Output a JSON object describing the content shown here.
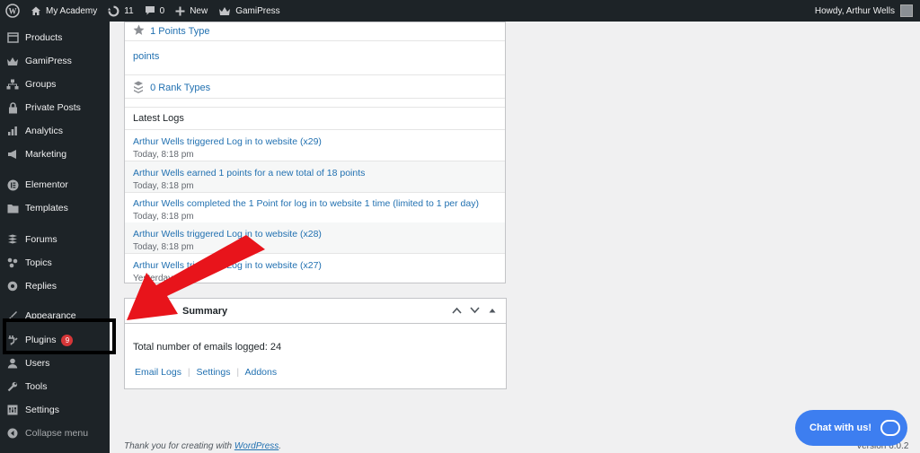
{
  "adminbar": {
    "site_name": "My Academy",
    "updates_count": "11",
    "comments_count": "0",
    "new_label": "New",
    "gamipress_label": "GamiPress",
    "howdy": "Howdy, Arthur Wells"
  },
  "sidebar": {
    "items": [
      {
        "label": "Products",
        "icon": "products-icon"
      },
      {
        "label": "GamiPress",
        "icon": "crown-icon"
      },
      {
        "label": "Groups",
        "icon": "groups-icon"
      },
      {
        "label": "Private Posts",
        "icon": "lock-icon"
      },
      {
        "label": "Analytics",
        "icon": "analytics-icon"
      },
      {
        "label": "Marketing",
        "icon": "megaphone-icon"
      },
      {
        "label": "Elementor",
        "icon": "elementor-icon"
      },
      {
        "label": "Templates",
        "icon": "folder-icon"
      },
      {
        "label": "Forums",
        "icon": "forums-icon"
      },
      {
        "label": "Topics",
        "icon": "topics-icon"
      },
      {
        "label": "Replies",
        "icon": "replies-icon"
      },
      {
        "label": "Appearance",
        "icon": "brush-icon"
      },
      {
        "label": "Plugins",
        "icon": "plugin-icon",
        "badge": "9"
      },
      {
        "label": "Users",
        "icon": "user-icon"
      },
      {
        "label": "Tools",
        "icon": "wrench-icon"
      },
      {
        "label": "Settings",
        "icon": "settings-icon"
      },
      {
        "label": "Collapse menu",
        "icon": "collapse-icon"
      }
    ]
  },
  "gamipress": {
    "points_types": "1 Points Type",
    "points_item": "points",
    "rank_types": "0 Rank Types",
    "latest_logs_title": "Latest Logs",
    "logs": [
      {
        "text": "Arthur Wells triggered Log in to website (x29)",
        "time": "Today, 8:18 pm"
      },
      {
        "text": "Arthur Wells earned 1 points for a new total of 18 points",
        "time": "Today, 8:18 pm"
      },
      {
        "text": "Arthur Wells completed the 1 Point for log in to website 1 time (limited to 1 per day)",
        "time": "Today, 8:18 pm"
      },
      {
        "text": "Arthur Wells triggered Log in to website (x28)",
        "time": "Today, 8:18 pm"
      },
      {
        "text": "Arthur Wells triggered Log in to website (x27)",
        "time": "Yesterday"
      }
    ]
  },
  "email_summary": {
    "title": "Summary",
    "total": "Total number of emails logged: 24",
    "links": [
      "Email Logs",
      "Settings",
      "Addons"
    ]
  },
  "chat": {
    "label": "Chat with us!"
  },
  "footer": {
    "thanks_prefix": "Thank you for creating with ",
    "thanks_link": "WordPress",
    "thanks_suffix": ".",
    "version": "Version 6.0.2"
  },
  "colors": {
    "accent": "#2271b1",
    "adminbar": "#1d2327",
    "badge": "#d63638",
    "arrow": "#e8141b",
    "chat": "#3d7ef0"
  }
}
